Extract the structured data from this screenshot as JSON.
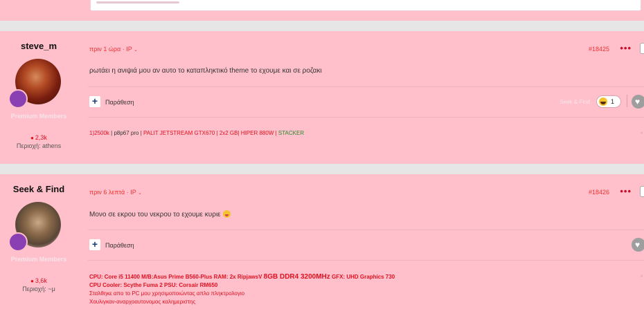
{
  "posts": [
    {
      "author": "steve_m",
      "group": "Premium Members",
      "reputation": "2,3k",
      "location": "Περιοχή: athens",
      "time": "πριν 1 ώρα",
      "ip": "IP",
      "number": "#18425",
      "content": "ρωτάει η ανιψιά μου αν αυτο το καταπληκτικό theme το εχουμε και σε ροζακι",
      "quote_label": "Παράθεση",
      "reaction_by": "Seek & Find",
      "reaction_count": "1",
      "signature": [
        {
          "text": "1)2500k",
          "style": "red"
        },
        {
          "text": " | p8p67 pro | ",
          "style": "dark"
        },
        {
          "text": "PALIT JETSTREAM GTX670 | 2x2 GB",
          "style": "red"
        },
        {
          "text": "| HIPER 880W | ",
          "style": "red"
        },
        {
          "text": "STACKER",
          "style": "green"
        }
      ]
    },
    {
      "author": "Seek & Find",
      "group": "Premium Members",
      "reputation": "3,6k",
      "location": "Περιοχή: ~μ",
      "time": "πριν 6 λεπτά",
      "ip": "IP",
      "number": "#18426",
      "content": "Μονο σε εκρου του νεκρου το εχουμε κυριε",
      "quote_label": "Παράθεση",
      "signature": {
        "line1": [
          {
            "text": "CPU: Core i5 11400 M/B:Asus Prime B560-Plus RAM: 2x RipjawsV ",
            "style": "bold"
          },
          {
            "text": "8GB DDR4 3200MHz",
            "style": "big"
          },
          {
            "text": " GFX: UHD Graphics 730",
            "style": "bold"
          }
        ],
        "line2": "CPU Cooler: Scythe Fuma 2 PSU: Corsair RM650",
        "line3": "Σταλθηκε απο το PC μου χρησιμοποιώντας απλο πληκτρολογιο",
        "line4": "Χουλιγκαν-αναρχοαυτονομος καλημεριστης"
      }
    }
  ],
  "icons": {
    "more": "•••",
    "close": "×",
    "heart": "♥",
    "chevron": "⌄",
    "plus": "+",
    "dot": "·"
  }
}
